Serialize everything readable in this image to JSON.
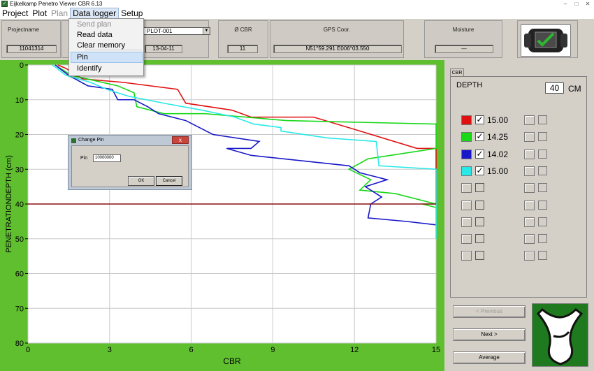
{
  "window": {
    "title": "Eijkelkamp Penetro Viewer CBR  6.13",
    "minimize": "–",
    "maximize": "□",
    "close": "✕"
  },
  "menu": {
    "items": [
      {
        "label": "Project",
        "state": "normal"
      },
      {
        "label": "Plot",
        "state": "normal"
      },
      {
        "label": "Plan",
        "state": "disabled"
      },
      {
        "label": "Data logger",
        "state": "active"
      },
      {
        "label": "Setup",
        "state": "normal"
      }
    ]
  },
  "dropdown": {
    "items": [
      {
        "label": "Send plan",
        "state": "disabled"
      },
      {
        "label": "Read data",
        "state": "normal"
      },
      {
        "label": "Clear memory",
        "state": "normal"
      },
      {
        "label": "Pin",
        "state": "highlighted"
      },
      {
        "label": "Identify",
        "state": "normal"
      }
    ]
  },
  "header": {
    "projectname_label": "Projectname",
    "projectname_value": "11041314",
    "plot_value": "PLOT-001",
    "date_value": "13-04-11",
    "cbr_label": "Ø CBR",
    "cbr_value": "11",
    "gps_label": "GPS Coor.",
    "gps_value": "N51°59.291 E006°03.550",
    "moisture_label": "Moisture",
    "moisture_value": "---"
  },
  "dialog": {
    "title": "Change Pin",
    "close": "x",
    "pin_label": "Pin",
    "pin_value": "10000000",
    "ok_label": "OK",
    "cancel_label": "Cancel"
  },
  "right_panel": {
    "tab_label": "CBR",
    "depth_label": "DEPTH",
    "depth_value": "40",
    "depth_unit": "CM",
    "series_rows": [
      {
        "color": "#e01010",
        "checked": true,
        "value": "15.00"
      },
      {
        "color": "#18d818",
        "checked": true,
        "value": "14.25"
      },
      {
        "color": "#1818c8",
        "checked": true,
        "value": "14.02"
      },
      {
        "color": "#28e8e8",
        "checked": true,
        "value": "15.00"
      },
      {
        "color": "",
        "checked": false,
        "value": ""
      },
      {
        "color": "",
        "checked": false,
        "value": ""
      },
      {
        "color": "",
        "checked": false,
        "value": ""
      },
      {
        "color": "",
        "checked": false,
        "value": ""
      },
      {
        "color": "",
        "checked": false,
        "value": ""
      }
    ],
    "previous_label": "< Previous",
    "next_label": "Next >",
    "average_label": "Average"
  },
  "chart_data": {
    "type": "line",
    "xlabel": "CBR",
    "ylabel": "PENETRATIONDEPTH (cm)",
    "xlim": [
      0,
      15
    ],
    "ylim": [
      0,
      80
    ],
    "y_inverted": true,
    "x_ticks": [
      0,
      3,
      6,
      9,
      12,
      15
    ],
    "y_ticks": [
      0,
      10,
      20,
      30,
      40,
      50,
      60,
      70,
      80
    ],
    "grid": true,
    "depth_marker": 40,
    "series": [
      {
        "color": "#e01010",
        "x": [
          1.1,
          1.4,
          2.0,
          3.5,
          5.5,
          5.8,
          7.5,
          8.2,
          10.5,
          12.2,
          14.3,
          15.0,
          15.0,
          15.0,
          15.0
        ],
        "y": [
          0,
          1,
          4,
          5,
          7,
          11,
          13,
          15,
          15,
          19,
          24,
          24,
          30,
          38,
          40
        ]
      },
      {
        "color": "#18d818",
        "x": [
          1.0,
          1.6,
          3.3,
          3.9,
          4.0,
          4.5,
          5.0,
          6.5,
          9.5,
          15.0,
          15.0,
          12.5,
          11.8,
          12.6,
          12.2,
          13.5,
          15.0,
          14.5,
          15.0
        ],
        "y": [
          0,
          3,
          6,
          8,
          12,
          13,
          14,
          14,
          16,
          17,
          24,
          27,
          30,
          33,
          36,
          37,
          40,
          40,
          41
        ]
      },
      {
        "color": "#1818c8",
        "x": [
          1.0,
          1.5,
          2.2,
          3.1,
          3.3,
          3.9,
          4.4,
          4.8,
          5.8,
          6.8,
          8.5,
          8.2,
          7.3,
          8.2,
          11.8,
          12.2,
          13.2,
          12.4,
          13.0,
          12.6,
          12.5,
          13.9,
          15.0
        ],
        "y": [
          0,
          3,
          6,
          7,
          10,
          10,
          12,
          14,
          16,
          20,
          22,
          24,
          24,
          26,
          29,
          31,
          33,
          35,
          38,
          40,
          44,
          45,
          46
        ]
      },
      {
        "color": "#28e8e8",
        "x": [
          0.9,
          1.4,
          2.3,
          2.9,
          3.7,
          5.0,
          6.4,
          7.6,
          8.3,
          9.3,
          9.3,
          11.0,
          12.8,
          12.9,
          15.0,
          15.0
        ],
        "y": [
          0,
          3,
          5,
          7,
          9,
          11,
          13,
          15,
          17,
          18,
          19,
          21,
          22,
          29,
          30,
          50
        ]
      }
    ]
  }
}
